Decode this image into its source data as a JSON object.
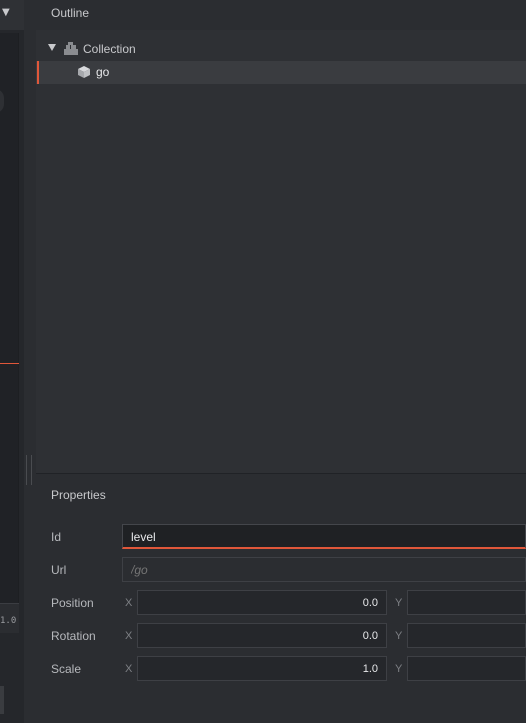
{
  "left_pane": {
    "timeline_label": "1.0"
  },
  "outline": {
    "title": "Outline",
    "items": [
      {
        "label": "Collection",
        "icon": "collection-icon",
        "expanded": true
      },
      {
        "label": "go",
        "icon": "game-object-icon",
        "selected": true
      }
    ]
  },
  "properties": {
    "title": "Properties",
    "id": {
      "label": "Id",
      "value": "level"
    },
    "url": {
      "label": "Url",
      "placeholder": "/go"
    },
    "position": {
      "label": "Position",
      "x_axis": "X",
      "x": "0.0",
      "y_axis": "Y"
    },
    "rotation": {
      "label": "Rotation",
      "x_axis": "X",
      "x": "0.0",
      "y_axis": "Y"
    },
    "scale": {
      "label": "Scale",
      "x_axis": "X",
      "x": "1.0",
      "y_axis": "Y"
    }
  },
  "colors": {
    "accent": "#e0573a",
    "panel_bg": "#2e3034",
    "field_bg": "#25272b"
  }
}
